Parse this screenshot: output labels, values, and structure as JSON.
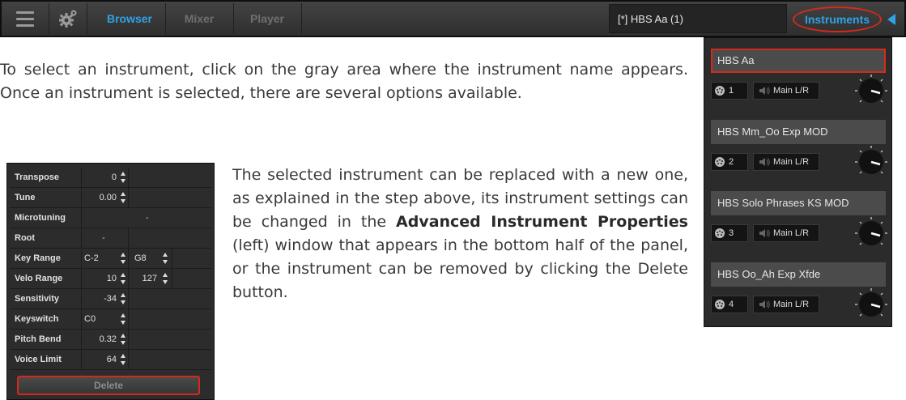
{
  "toolbar": {
    "menu_icon": "hamburger-menu-icon",
    "settings_icon": "gear-icon",
    "tabs": [
      {
        "label": "Browser",
        "active": true
      },
      {
        "label": "Mixer",
        "active": false
      },
      {
        "label": "Player",
        "active": false
      }
    ],
    "preset_name": "[*] HBS Aa (1)",
    "instruments_label": "Instruments",
    "instruments_arrow_icon": "triangle-left-icon",
    "accent_color": "#2ea3e6",
    "highlight_color": "#d42a1c"
  },
  "text": {
    "para1": "To select an instrument, click on the gray area where the instrument name appears. Once an instrument is selected, there are several op­tions available.",
    "para2_a": "The selected instrument can be replaced with a new one, as explained in the step above, its instrument settings can be changed in the ",
    "para2_bold": "Advanced Instrument Properties",
    "para2_b": " (left) window that appears in the bottom half of the panel, or the instrument can be removed by clicking the Delete button."
  },
  "rack": {
    "slots": [
      {
        "name": "HBS Aa",
        "midi": "1",
        "output": "Main L/R",
        "selected": true
      },
      {
        "name": "HBS Mm_Oo Exp MOD",
        "midi": "2",
        "output": "Main L/R",
        "selected": false
      },
      {
        "name": "HBS Solo Phrases KS MOD",
        "midi": "3",
        "output": "Main L/R",
        "selected": false
      },
      {
        "name": "HBS Oo_Ah Exp Xfde",
        "midi": "4",
        "output": "Main L/R",
        "selected": false
      }
    ]
  },
  "properties": {
    "rows": [
      {
        "label": "Transpose",
        "value": "0"
      },
      {
        "label": "Tune",
        "value": "0.00"
      },
      {
        "label": "Microtuning",
        "value": "-"
      },
      {
        "label": "Root",
        "value": "-"
      },
      {
        "label": "Key Range",
        "value": "C-2",
        "value2": "G8"
      },
      {
        "label": "Velo Range",
        "value": "10",
        "value2": "127"
      },
      {
        "label": "Sensitivity",
        "value": "-34"
      },
      {
        "label": "Keyswitch",
        "value": "C0"
      },
      {
        "label": "Pitch Bend",
        "value": "0.32"
      },
      {
        "label": "Voice Limit",
        "value": "64"
      }
    ],
    "delete_label": "Delete"
  }
}
